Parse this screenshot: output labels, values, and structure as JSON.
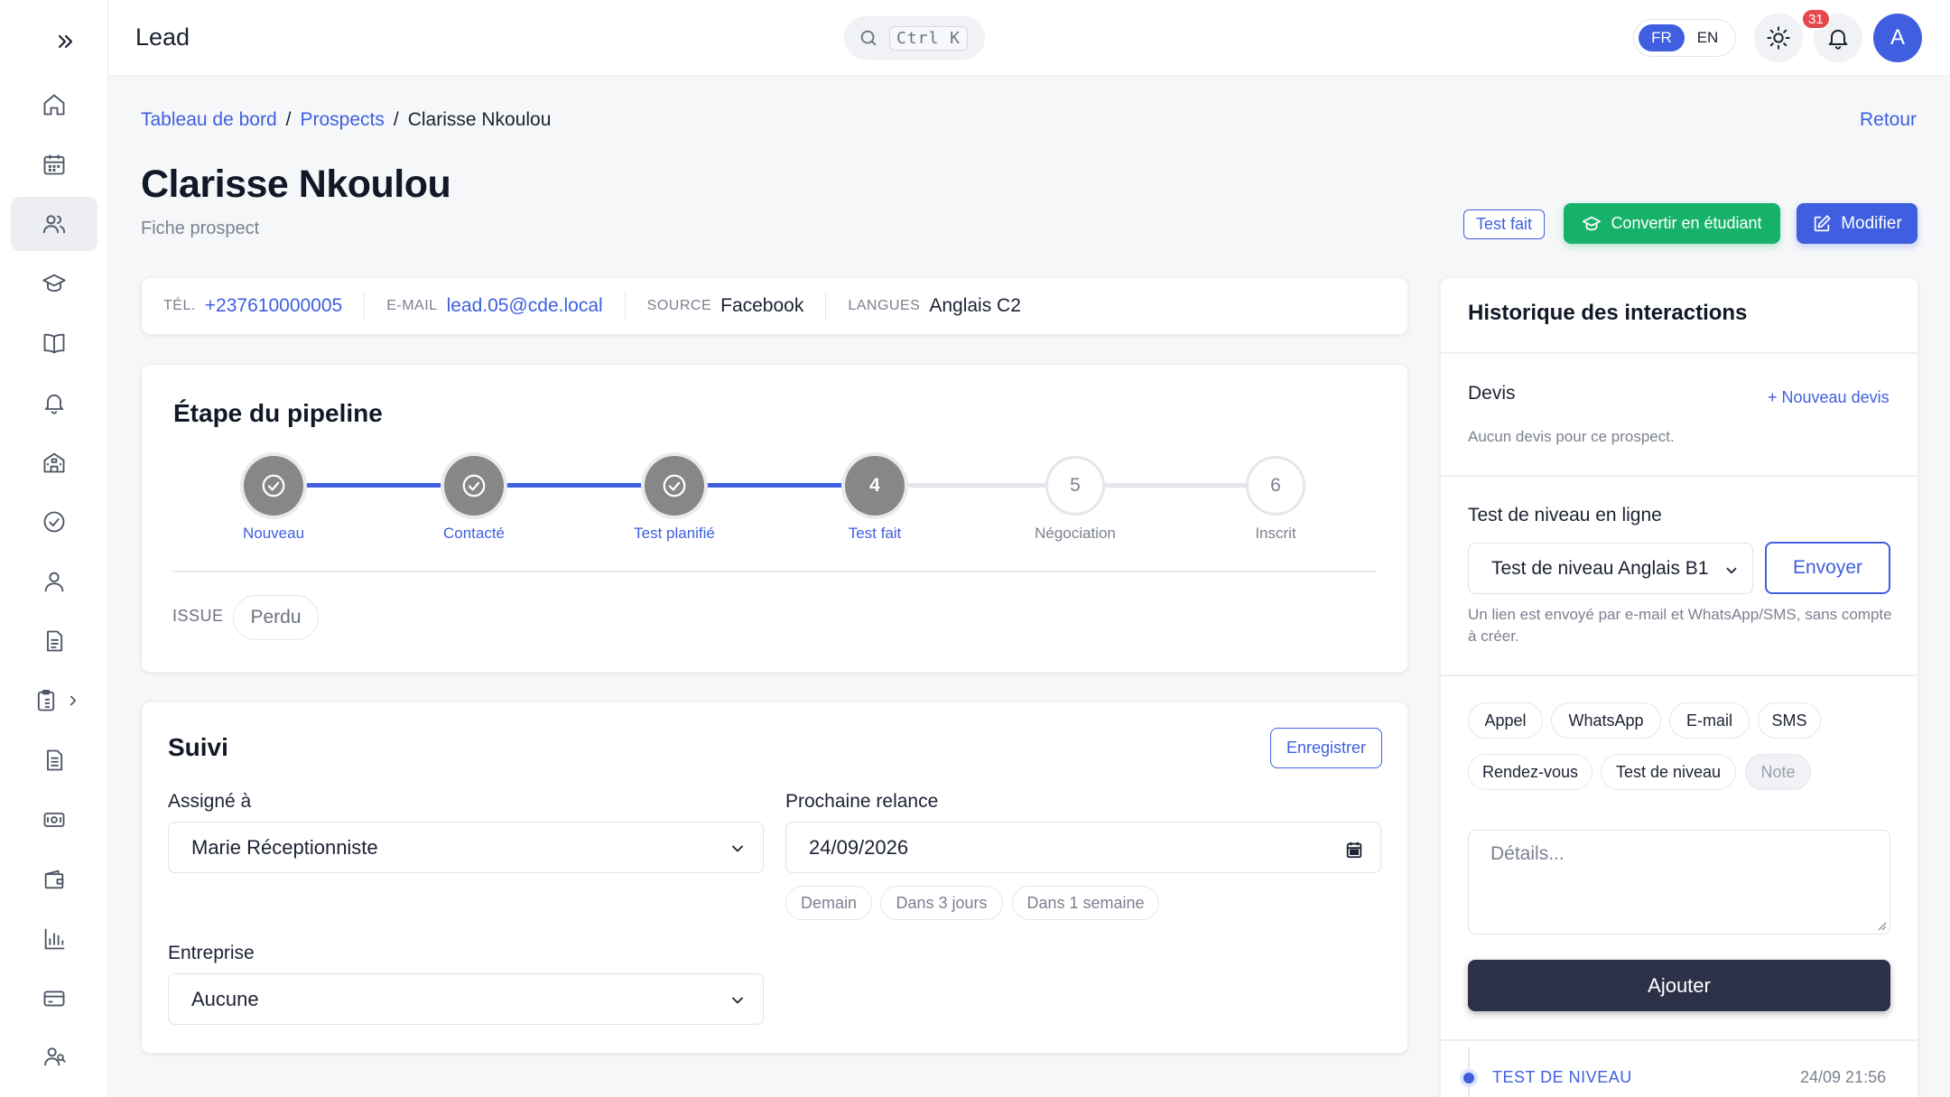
{
  "app": {
    "title": "Lead"
  },
  "search": {
    "shortcut": "Ctrl K"
  },
  "lang": {
    "options": [
      "FR",
      "EN"
    ],
    "selected": "FR"
  },
  "notifications": {
    "count": "31"
  },
  "user": {
    "avatar_initial": "A"
  },
  "sidebar": {
    "items": [
      {
        "icon": "home-icon"
      },
      {
        "icon": "calendar-icon"
      },
      {
        "icon": "users-icon",
        "active": true
      },
      {
        "icon": "graduation-cap-icon"
      },
      {
        "icon": "book-open-icon"
      },
      {
        "icon": "bell-icon"
      },
      {
        "icon": "building-icon"
      },
      {
        "icon": "check-circle-icon"
      },
      {
        "icon": "user-icon"
      },
      {
        "icon": "document-icon"
      },
      {
        "icon": "clipboard-icon",
        "expandable": true
      },
      {
        "icon": "file-icon"
      },
      {
        "icon": "money-icon"
      },
      {
        "icon": "wallet-icon"
      },
      {
        "icon": "bar-chart-icon"
      },
      {
        "icon": "credit-card-icon"
      },
      {
        "icon": "team-icon"
      }
    ]
  },
  "breadcrumb": {
    "items": [
      "Tableau de bord",
      "Prospects",
      "Clarisse Nkoulou"
    ],
    "separator": "/"
  },
  "header": {
    "back": "Retour",
    "title": "Clarisse Nkoulou",
    "subtitle": "Fiche prospect",
    "status_badge": "Test fait",
    "convert_button": "Convertir en étudiant",
    "edit_button": "Modifier"
  },
  "contact": {
    "phone": {
      "label": "TÉL.",
      "value": "+237610000005"
    },
    "email": {
      "label": "E-MAIL",
      "value": "lead.05@cde.local"
    },
    "source": {
      "label": "SOURCE",
      "value": "Facebook"
    },
    "languages": {
      "label": "LANGUES",
      "value": "Anglais C2"
    }
  },
  "pipeline": {
    "title": "Étape du pipeline",
    "current_step": 4,
    "steps": [
      {
        "n": "1",
        "label": "Nouveau",
        "state": "done"
      },
      {
        "n": "2",
        "label": "Contacté",
        "state": "done"
      },
      {
        "n": "3",
        "label": "Test planifié",
        "state": "done"
      },
      {
        "n": "4",
        "label": "Test fait",
        "state": "current"
      },
      {
        "n": "5",
        "label": "Négociation",
        "state": "todo"
      },
      {
        "n": "6",
        "label": "Inscrit",
        "state": "todo"
      }
    ],
    "issue": {
      "label": "ISSUE",
      "value": "Perdu"
    }
  },
  "followup": {
    "title": "Suivi",
    "save_button": "Enregistrer",
    "assigned": {
      "label": "Assigné à",
      "value": "Marie Réceptionniste"
    },
    "next_reminder": {
      "label": "Prochaine relance",
      "value": "24/09/2026"
    },
    "quick_dates": [
      "Demain",
      "Dans 3 jours",
      "Dans 1 semaine"
    ],
    "company": {
      "label": "Entreprise",
      "value": "Aucune"
    }
  },
  "history": {
    "title": "Historique des interactions",
    "quotes": {
      "title": "Devis",
      "add_link": "+ Nouveau devis",
      "empty": "Aucun devis pour ce prospect."
    },
    "online_test": {
      "title": "Test de niveau en ligne",
      "selected": "Test de niveau Anglais B1",
      "send_button": "Envoyer",
      "help": "Un lien est envoyé par e-mail et WhatsApp/SMS, sans compte à créer."
    },
    "types": [
      "Appel",
      "WhatsApp",
      "E-mail",
      "SMS",
      "Rendez-vous",
      "Test de niveau",
      "Note"
    ],
    "details_placeholder": "Détails...",
    "add_button": "Ajouter",
    "entries": [
      {
        "type": "TEST DE NIVEAU",
        "time": "24/09 21:56"
      }
    ]
  },
  "colors": {
    "accent": "#3f5fe0",
    "success": "#17b26a",
    "dark": "#2d3148",
    "danger": "#e5484d"
  }
}
